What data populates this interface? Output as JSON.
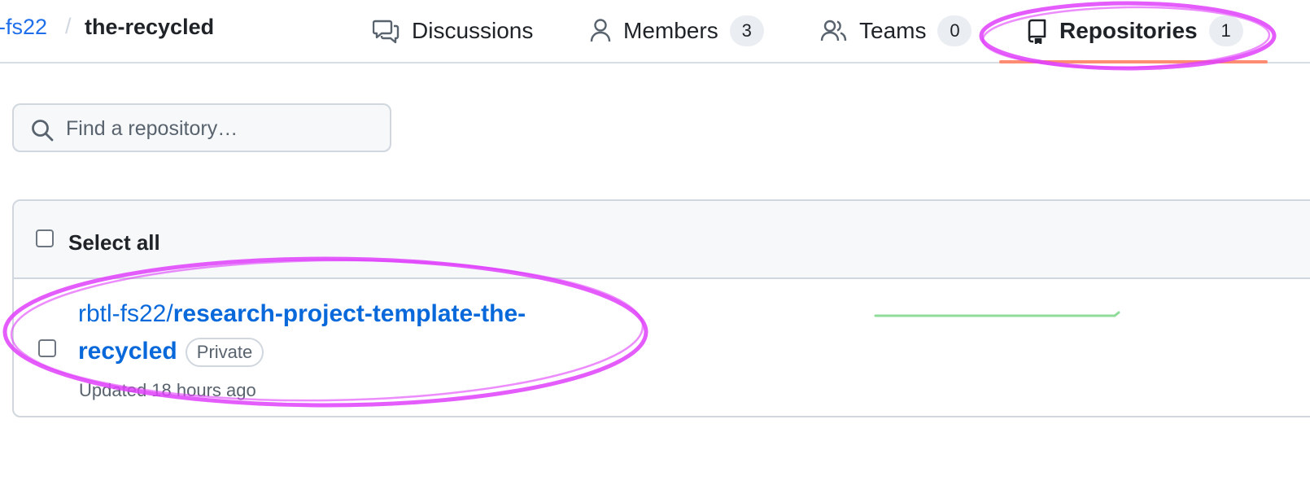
{
  "breadcrumb": {
    "org": "-fs22",
    "separator": "/",
    "team": "the-recycled"
  },
  "nav": {
    "discussions": {
      "label": "Discussions",
      "icon": "comment-discussion-icon"
    },
    "members": {
      "label": "Members",
      "count": "3",
      "icon": "person-icon"
    },
    "teams": {
      "label": "Teams",
      "count": "0",
      "icon": "people-icon"
    },
    "repositories": {
      "label": "Repositories",
      "count": "1",
      "icon": "repo-icon",
      "selected": true
    }
  },
  "search": {
    "placeholder": "Find a repository…",
    "value": ""
  },
  "repo_list": {
    "select_all_label": "Select all",
    "rows": [
      {
        "owner": "rbtl-fs22/",
        "name": "research-project-template-the-recycled",
        "visibility": "Private",
        "updated": "Updated 18 hours ago"
      }
    ]
  },
  "colors": {
    "link": "#0969da",
    "selected_underline": "#fd8c73",
    "annotation_magenta": "#e040fb",
    "annotation_green": "#8fdc9a"
  }
}
